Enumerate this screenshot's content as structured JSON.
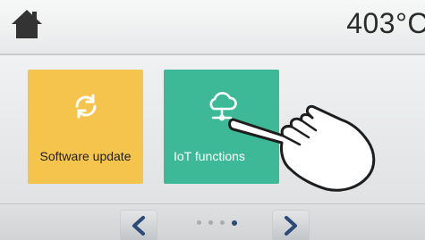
{
  "header": {
    "home_icon": "home-icon",
    "temperature": "403°C"
  },
  "tiles": [
    {
      "label": "Software update",
      "icon": "refresh-icon",
      "color": "#f5c44d"
    },
    {
      "label": "IoT functions",
      "icon": "cloud-network-icon",
      "color": "#3db997"
    }
  ],
  "pager": {
    "prev_icon": "chevron-left-icon",
    "next_icon": "chevron-right-icon",
    "page_count": 4,
    "current_page": 4,
    "active_color": "#2c4a78"
  },
  "overlay": {
    "icon": "pointing-hand-icon"
  }
}
